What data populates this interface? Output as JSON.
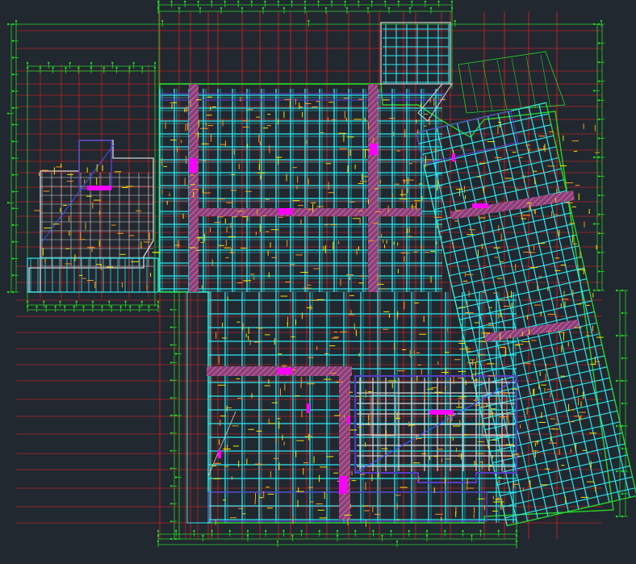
{
  "drawing": {
    "title": "",
    "colors": {
      "background": "#212830",
      "axis_red": "#ff1e1e",
      "grid_green": "#29d329",
      "beam_cyan": "#2ee8f0",
      "core_white": "#d8d8d8",
      "slab_purple": "#5a3cc8",
      "hatch_pink": "#c86aa0",
      "highlight_magenta": "#ff00ff",
      "annotation_yellow": "#f2e600",
      "annotation_orange": "#ff9a1a",
      "diagonal_blue": "#3b5bff"
    }
  }
}
